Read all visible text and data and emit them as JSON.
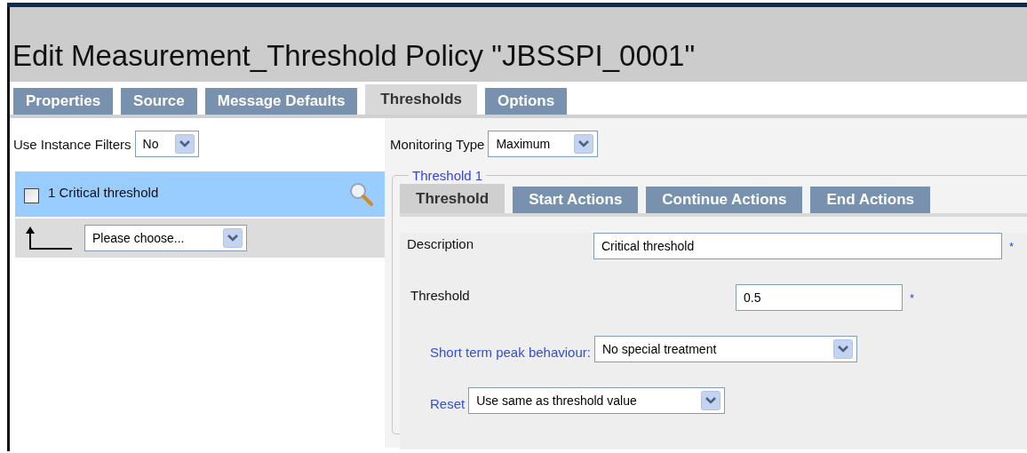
{
  "title": "Edit Measurement_Threshold Policy \"JBSSPI_0001\"",
  "tabs": [
    {
      "label": "Properties",
      "selected": false
    },
    {
      "label": "Source",
      "selected": false
    },
    {
      "label": "Message Defaults",
      "selected": false
    },
    {
      "label": "Thresholds",
      "selected": true
    },
    {
      "label": "Options",
      "selected": false
    }
  ],
  "instance_filters": {
    "label": "Use Instance Filters",
    "value": "No"
  },
  "threshold_list": [
    {
      "label": "1 Critical threshold",
      "checked": false,
      "selected": true
    }
  ],
  "move_select": {
    "value": "Please choose..."
  },
  "monitoring_type": {
    "label": "Monitoring Type",
    "value": "Maximum"
  },
  "threshold_group": {
    "legend": "Threshold 1",
    "tabs": [
      {
        "label": "Threshold",
        "selected": true
      },
      {
        "label": "Start Actions",
        "selected": false
      },
      {
        "label": "Continue Actions",
        "selected": false
      },
      {
        "label": "End Actions",
        "selected": false
      }
    ],
    "fields": [
      {
        "kind": "input",
        "label": "Description",
        "link": false,
        "value": "Critical threshold",
        "required_mark": "*"
      },
      {
        "kind": "input",
        "label": "Threshold",
        "link": false,
        "value": "0.5",
        "required_mark": "*"
      },
      {
        "kind": "select",
        "label": "Short term peak behaviour:",
        "link": true,
        "value": "No special treatment"
      },
      {
        "kind": "select",
        "label": "Reset",
        "link": true,
        "value": "Use same as threshold value"
      }
    ]
  }
}
